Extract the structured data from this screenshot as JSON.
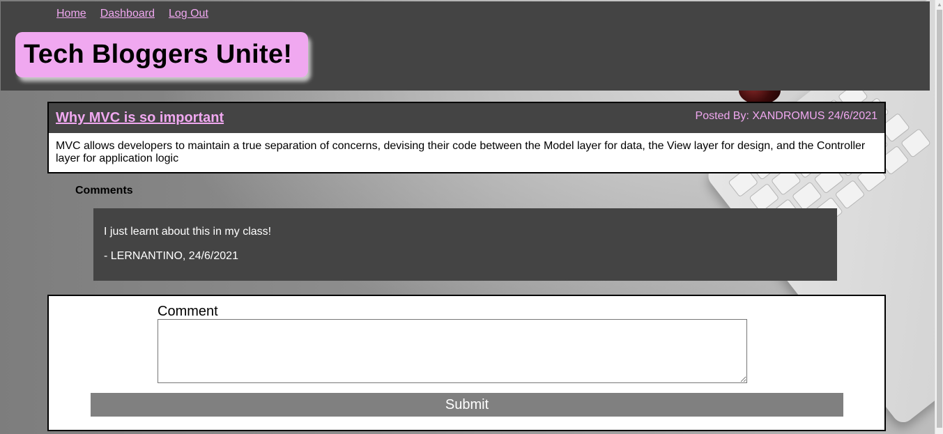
{
  "nav": {
    "home": "Home",
    "dashboard": "Dashboard",
    "logout": "Log Out"
  },
  "brand": {
    "title": "Tech Bloggers Unite!"
  },
  "post": {
    "title": "Why MVC is so important",
    "meta": "Posted By: XANDROMUS 24/6/2021",
    "body": "MVC allows developers to maintain a true separation of concerns, devising their code between the Model layer for data, the View layer for design, and the Controller layer for application logic"
  },
  "comments": {
    "heading": "Comments",
    "items": [
      {
        "text": "I just learnt about this in my class!",
        "byline": "- LERNANTINO, 24/6/2021"
      }
    ]
  },
  "form": {
    "label": "Comment",
    "value": "",
    "submit": "Submit"
  },
  "colors": {
    "header_bg": "#444444",
    "accent_pink": "#f0a8f0",
    "button_gray": "#808080"
  }
}
